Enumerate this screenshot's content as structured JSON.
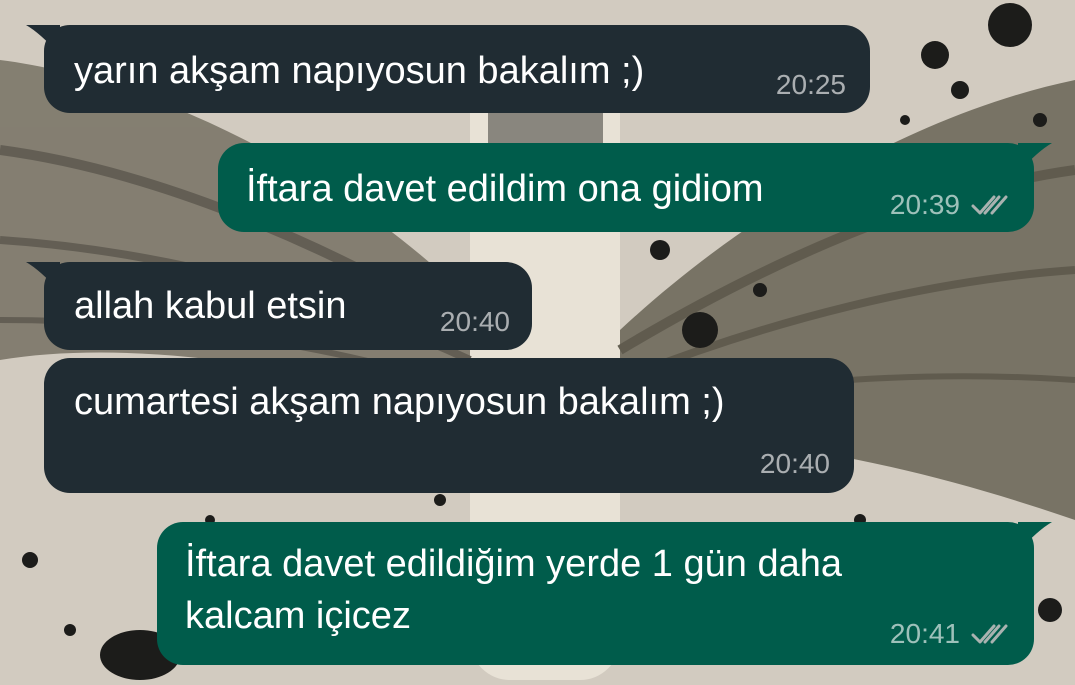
{
  "colors": {
    "incoming_bubble": "#202c33",
    "outgoing_bubble": "#005c4b",
    "message_text": "#ffffff",
    "timestamp_text": "#a9b2b0",
    "read_ticks": "#a9b2b0"
  },
  "wallpaper": {
    "icon": "winged-figure-ink-splatter"
  },
  "messages": [
    {
      "direction": "incoming",
      "text": "yarın akşam napıyosun bakalım ;)",
      "time": "20:25"
    },
    {
      "direction": "outgoing",
      "text": "İftara davet edildim ona gidiom",
      "time": "20:39",
      "status_icon": "double-check-icon"
    },
    {
      "direction": "incoming",
      "text": "allah kabul etsin",
      "time": "20:40"
    },
    {
      "direction": "incoming",
      "text": "cumartesi akşam napıyosun bakalım ;)",
      "time": "20:40"
    },
    {
      "direction": "outgoing",
      "lines": [
        "İftara davet edildiğim yerde 1 gün daha",
        "kalcam içicez"
      ],
      "time": "20:41",
      "status_icon": "double-check-icon"
    }
  ]
}
